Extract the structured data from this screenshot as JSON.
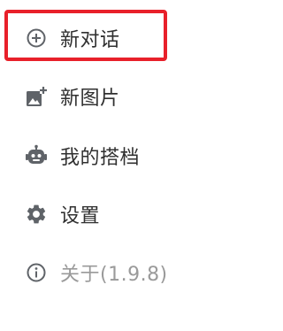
{
  "menu": {
    "items": [
      {
        "id": "new-chat",
        "label": "新对话",
        "icon": "add-circle-icon",
        "selected": true
      },
      {
        "id": "new-image",
        "label": "新图片",
        "icon": "add-photo-icon"
      },
      {
        "id": "my-partner",
        "label": "我的搭档",
        "icon": "robot-icon"
      },
      {
        "id": "settings",
        "label": "设置",
        "icon": "gear-icon"
      },
      {
        "id": "about",
        "label": "关于(1.9.8)",
        "icon": "info-circle-icon",
        "muted": true
      }
    ]
  },
  "colors": {
    "text": "#303030",
    "icon": "#5f6368",
    "muted": "#9a9a9a",
    "highlight_border": "#e8202a"
  }
}
